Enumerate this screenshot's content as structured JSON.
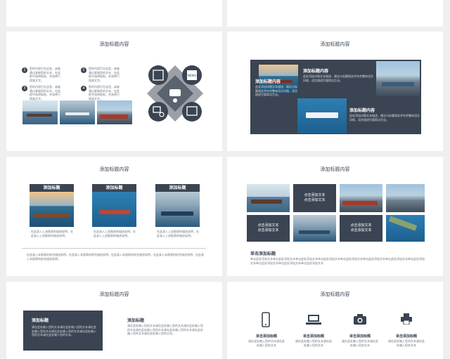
{
  "slide_title": "添加标题内容",
  "s2": {
    "items": [
      {
        "num": "1",
        "text": "您的内容打在这里，或者通过复制您的文本，在此框中选择粘贴，并选择只保留文字。"
      },
      {
        "num": "2",
        "text": "您的内容打在这里，或者通过复制您的文本，在此框中选择粘贴，并选择只保留文字。"
      },
      {
        "num": "3",
        "text": "您的内容打在这里，或者通过复制您的文本，在此框中选择粘贴，并选择只保留文字。"
      },
      {
        "num": "4",
        "text": "您的内容打在这里，或者通过复制您的文本，在此框中选择粘贴，并选择只保留文字。"
      }
    ],
    "icon_news": "NEWS"
  },
  "s3": {
    "heading1": "添加标题内容",
    "text1": "此处添加详细文本描述，建议与标题相关并符合整体语言风格，语言描述尽量简洁生动。",
    "heading2": "添加标题内容",
    "text2": "此处添加详细文本描述，建议与标题相关并符合整体语言风格，语言描述尽量简洁生动。",
    "heading3": "添加标题内容",
    "text3": "此处添加详细文本描述，建议与标题相关并符合整体语言风格，语言描述尽量简洁生动。"
  },
  "s4": {
    "cards": [
      {
        "label": "添加标题",
        "text": "在此录入上述图表的描述说明，在此录入上述图表的描述说明。"
      },
      {
        "label": "添加标题",
        "text": "在此录入上述图表的描述说明，在此录入上述图表的描述说明。"
      },
      {
        "label": "添加标题",
        "text": "在此录入上述图表的描述说明，在此录入上述图表的描述说明。"
      }
    ],
    "footer": "在此录入本图表的综合描述说明，在此录入本图表的综合描述说明，在此录入本图表的综合描述说明，在此录入本图表的综合描述说明，在此录入本图表的综合描述说明。"
  },
  "s5": {
    "tile1": "点击添加文本\n点击添加文本",
    "tile2": "点击添加文本\n点击添加文本",
    "tile3": "点击添加文本\n点击添加文本",
    "heading": "单击添加标题",
    "text": "单击此处添加文本单击此处添加文本单击此处添加文本单击此处添加文本单击此处添加文本单击此处添加文本单击此处添加文本单击此处添加文本单击此处添加文本单击此处添加文本单击此处添加文本"
  },
  "s6": {
    "box_heading": "添加标题",
    "box_text": "请在此处输入您的文本请在此处输入您的文本请在此处输入您的文本请在此处输入您的文本请在此处输入您的文本请在此处输入您的文本。",
    "heading": "添加标题",
    "text": "请在此处输入您的文本请在此处输入您的文本请在此处输入您的文本请在此处输入您的文本请在此处输入您的文本请在此处输入您的文本请在此处输入您的文本。"
  },
  "s7": {
    "items": [
      {
        "icon": "phone-icon",
        "label": "单击添加标题",
        "text": "请在此处输入您的文本请在此处输入您的文本"
      },
      {
        "icon": "laptop-icon",
        "label": "单击添加标题",
        "text": "请在此处输入您的文本请在此处输入您的文本"
      },
      {
        "icon": "camera-icon",
        "label": "单击添加标题",
        "text": "请在此处输入您的文本请在此处输入您的文本"
      },
      {
        "icon": "printer-icon",
        "label": "单击添加标题",
        "text": "请在此处输入您的文本请在此处输入您的文本"
      }
    ]
  }
}
